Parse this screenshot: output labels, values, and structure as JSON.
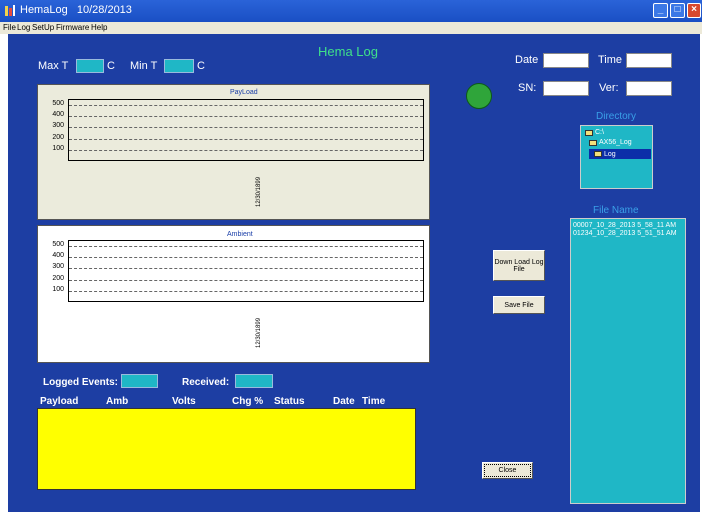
{
  "window": {
    "title": "HemaLog   10/28/2013",
    "min_label": "_",
    "max_label": "□",
    "close_label": "×"
  },
  "menu": [
    "File",
    "Log",
    "SetUp",
    "Firmware",
    "Help"
  ],
  "header": {
    "title": "Hema Log",
    "max_t_label": "Max T",
    "max_t_unit": "C",
    "min_t_label": "Min T",
    "min_t_unit": "C",
    "max_t_value": "",
    "min_t_value": ""
  },
  "info": {
    "date_label": "Date",
    "time_label": "Time",
    "sn_label": "SN:",
    "ver_label": "Ver:",
    "date_value": "",
    "time_value": "",
    "sn_value": "",
    "ver_value": "",
    "status_color": "#2fa53a"
  },
  "charts": {
    "payload": {
      "title": "PayLoad",
      "yticks": [
        "500",
        "400",
        "300",
        "200",
        "100"
      ],
      "xlabel": "12/30/1899"
    },
    "ambient": {
      "title": "Ambient",
      "yticks": [
        "500",
        "400",
        "300",
        "200",
        "100"
      ],
      "xlabel": "12/30/1899"
    }
  },
  "directory": {
    "label": "Directory",
    "items": [
      "C:\\",
      "AX56_Log",
      "Log"
    ],
    "selected": 2
  },
  "files": {
    "label": "File Name",
    "items": [
      "00007_10_28_2013 5_58_11 AM",
      "01234_10_28_2013 5_51_51 AM"
    ]
  },
  "buttons": {
    "download": "Down Load Log File",
    "save": "Save File",
    "close": "Close"
  },
  "events": {
    "logged_label": "Logged Events:",
    "received_label": "Received:",
    "logged_value": "",
    "received_value": "",
    "columns": [
      "Payload",
      "Amb",
      "Volts",
      "Chg %",
      "Status",
      "Date",
      "Time"
    ]
  },
  "colors": {
    "background": "#1d3ea3",
    "accent_cyan": "#1fb7c6",
    "title_green": "#3fe08a",
    "log_yellow": "#ffff00",
    "chart_panel": "#ebebdc"
  }
}
